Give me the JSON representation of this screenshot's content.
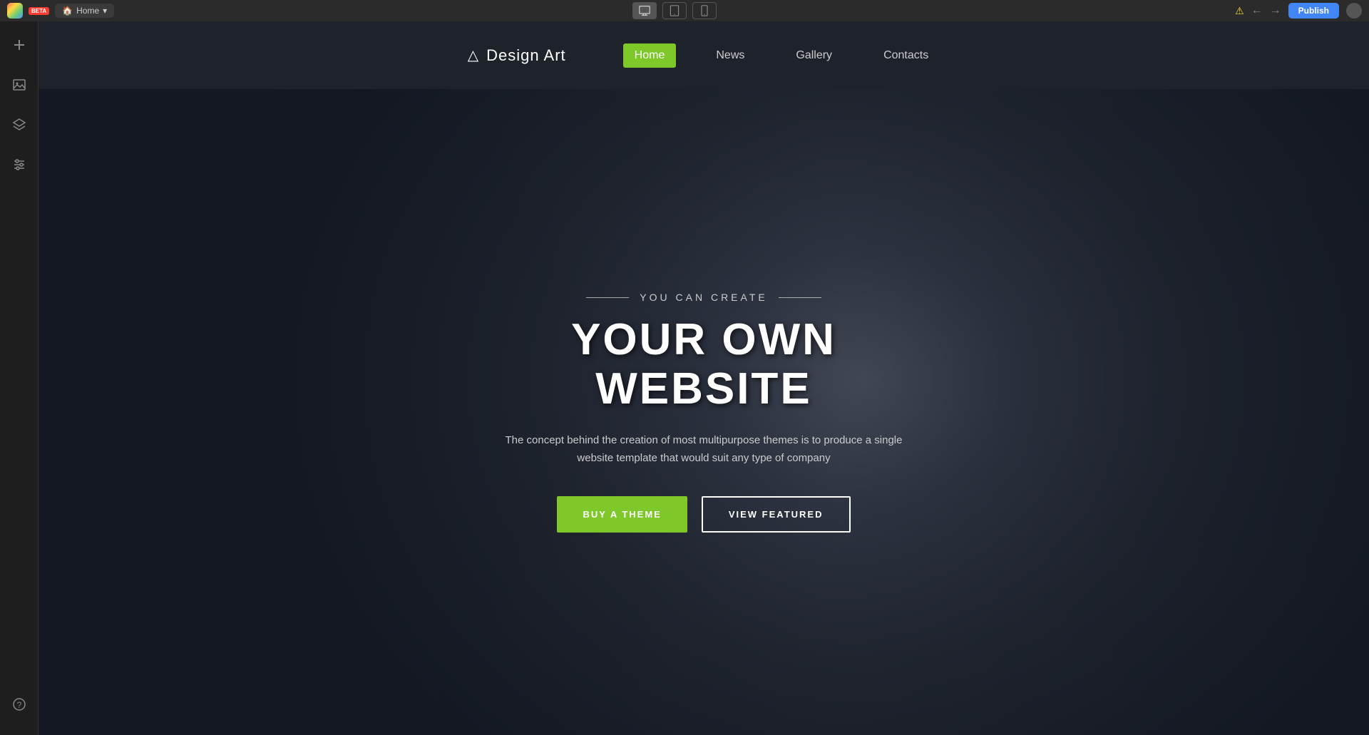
{
  "osbar": {
    "badge": "BETA",
    "home_tab": "Home",
    "home_chevron": "▾",
    "view_icons": [
      "desktop",
      "tablet",
      "mobile"
    ],
    "warning_icon": "⚠",
    "back_icon": "←",
    "forward_icon": "→",
    "publish_label": "Publish"
  },
  "sidebar": {
    "icons": [
      {
        "name": "add-icon",
        "symbol": "+"
      },
      {
        "name": "image-icon",
        "symbol": "▣"
      },
      {
        "name": "layers-icon",
        "symbol": "⊟"
      },
      {
        "name": "settings-icon",
        "symbol": "⚙"
      }
    ],
    "bottom_icon": {
      "name": "help-icon",
      "symbol": "?"
    }
  },
  "navbar": {
    "logo_icon": "△",
    "logo_text": "Design Art",
    "nav_items": [
      {
        "label": "Home",
        "active": true
      },
      {
        "label": "News",
        "active": false
      },
      {
        "label": "Gallery",
        "active": false
      },
      {
        "label": "Contacts",
        "active": false
      }
    ]
  },
  "hero": {
    "subtitle": "YOU CAN CREATE",
    "title": "YOUR OWN WEBSITE",
    "description": "The concept behind the creation of most multipurpose themes is to produce a single website template that would suit any type of company",
    "btn_primary": "BUY A THEME",
    "btn_secondary": "VIEW FEATURED",
    "line_char": "—"
  }
}
